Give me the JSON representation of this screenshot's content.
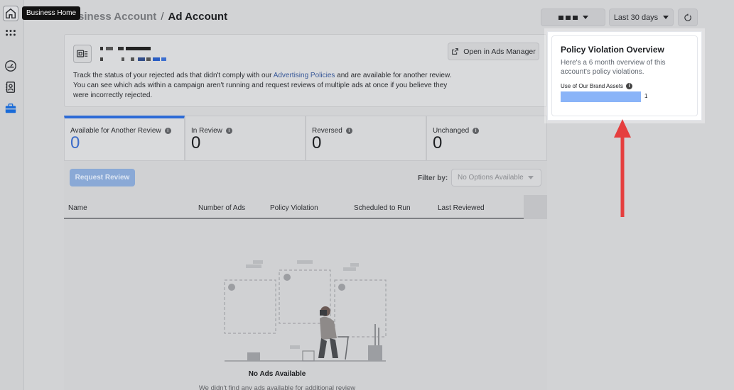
{
  "tooltip": "Business Home",
  "breadcrumb": {
    "parent": "Business Account",
    "separator": "/",
    "current": "Ad Account"
  },
  "header": {
    "date_range": "Last 30 days"
  },
  "info": {
    "text_before": "Track the status of your rejected ads that didn't comply with our ",
    "link": "Advertising Policies",
    "text_after": " and are available for another review. You can see which ads within a campaign aren't running and request reviews of multiple ads at once if you believe they were incorrectly rejected.",
    "open_button": "Open in Ads Manager"
  },
  "tabs": [
    {
      "label": "Available for Another Review",
      "value": "0"
    },
    {
      "label": "In Review",
      "value": "0"
    },
    {
      "label": "Reversed",
      "value": "0"
    },
    {
      "label": "Unchanged",
      "value": "0"
    }
  ],
  "toolbar": {
    "request_review": "Request Review",
    "filter_label": "Filter by:",
    "filter_value": "No Options Available"
  },
  "table": {
    "columns": [
      "Name",
      "Number of Ads",
      "Policy Violation",
      "Scheduled to Run",
      "Last Reviewed"
    ]
  },
  "empty": {
    "title": "No Ads Available",
    "subtitle": "We didn't find any ads available for additional review"
  },
  "overview": {
    "title": "Policy Violation Overview",
    "subtitle": "Here's a 6 month overview of this account's policy violations.",
    "metric_label": "Use of Our Brand Assets",
    "metric_count": "1"
  },
  "colors": {
    "accent": "#2d6bd6",
    "bar": "#8ab4f8",
    "arrow": "#e53e3e"
  }
}
